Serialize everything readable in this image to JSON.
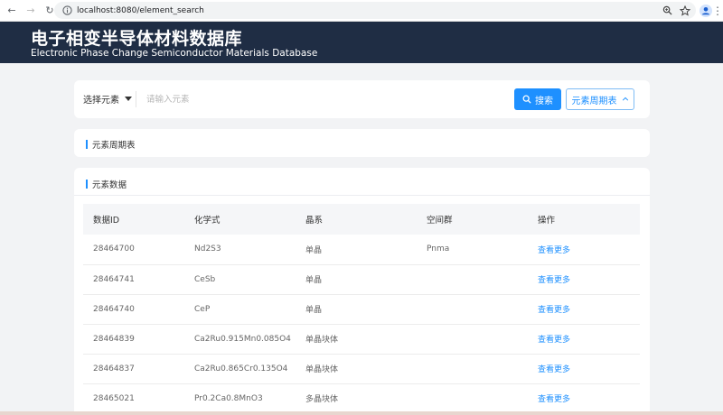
{
  "browser": {
    "url": "localhost:8080/element_search",
    "nav": {
      "back": "←",
      "forward": "→",
      "reload": "↻"
    },
    "icons": [
      "site-info-icon",
      "zoom-icon",
      "bookmark-star-icon",
      "profile-icon",
      "menu-icon"
    ]
  },
  "header": {
    "title_zh": "电子相变半导体材料数据库",
    "title_en": "Electronic Phase Change Semiconductor Materials Database",
    "background": "#1f2d44"
  },
  "search": {
    "select_label": "选择元素",
    "placeholder": "请输入元素",
    "search_button": "搜索",
    "periodic_button": "元素周期表",
    "accent": "#1e90ff"
  },
  "periodic_section": {
    "title": "元素周期表"
  },
  "data_section": {
    "title": "元素数据",
    "columns": [
      "数据ID",
      "化学式",
      "晶系",
      "空间群",
      "操作"
    ],
    "rows": [
      {
        "id": "28464700",
        "formula": "Nd2S3",
        "crystal": "单晶",
        "space_group": "Pnma",
        "action": "查看更多"
      },
      {
        "id": "28464741",
        "formula": "CeSb",
        "crystal": "单晶",
        "space_group": "",
        "action": "查看更多"
      },
      {
        "id": "28464740",
        "formula": "CeP",
        "crystal": "单晶",
        "space_group": "",
        "action": "查看更多"
      },
      {
        "id": "28464839",
        "formula": "Ca2Ru0.915Mn0.085O4",
        "crystal": "单晶块体",
        "space_group": "",
        "action": "查看更多"
      },
      {
        "id": "28464837",
        "formula": "Ca2Ru0.865Cr0.135O4",
        "crystal": "单晶块体",
        "space_group": "",
        "action": "查看更多"
      },
      {
        "id": "28465021",
        "formula": "Pr0.2Ca0.8MnO3",
        "crystal": "多晶块体",
        "space_group": "",
        "action": "查看更多"
      }
    ]
  }
}
